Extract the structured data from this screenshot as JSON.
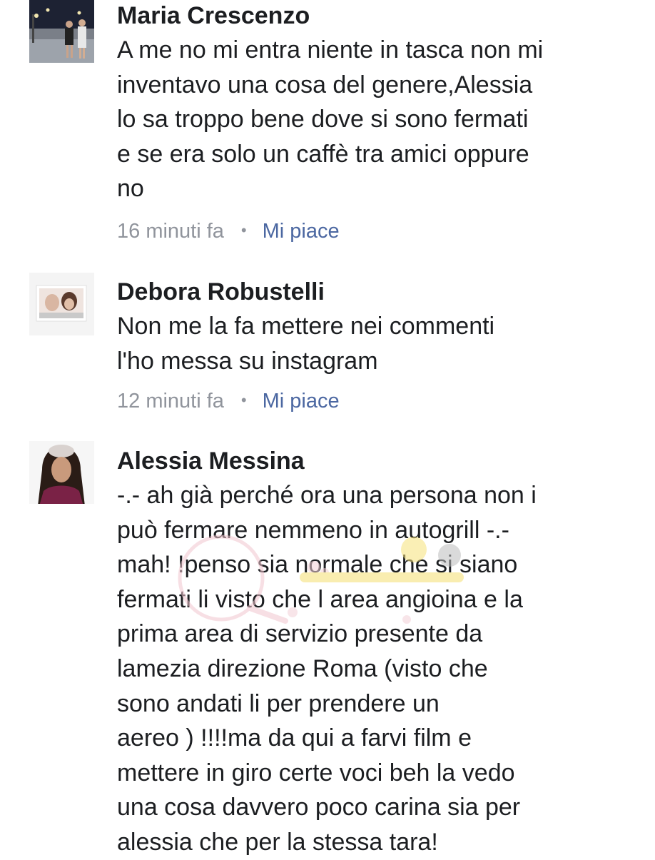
{
  "comments": [
    {
      "author": "Maria Crescenzo",
      "lines": [
        "A me no mi entra niente in tasca non mi",
        "inventavo una cosa del genere,Alessia",
        "lo sa troppo bene dove si sono fermati",
        "e se era solo un caffè tra amici oppure",
        "no"
      ],
      "time": "16 minuti fa",
      "separator": "•",
      "like_label": "Mi piace"
    },
    {
      "author": "Debora Robustelli",
      "lines": [
        "Non me la fa mettere  nei commenti",
        "l'ho messa su instagram"
      ],
      "time": "12 minuti fa",
      "separator": "•",
      "like_label": "Mi piace"
    },
    {
      "author": "Alessia Messina",
      "lines": [
        "-.- ah già perché ora una persona non i",
        "può fermare nemmeno in autogrill -.-",
        "mah! !penso sia normale che si siano",
        "fermati li visto che l area angioina e la",
        "prima area di servizio presente da",
        "lamezia direzione Roma  (visto che",
        "sono andati li per prendere un",
        "aereo ) !!!!ma da qui a farvi film e",
        "mettere in giro certe voci beh la vedo",
        "una cosa davvero poco carina sia per",
        "alessia che per la stessa tara!"
      ]
    }
  ],
  "colors": {
    "name": "#1c1e21",
    "meta": "#90949c",
    "like": "#4b67a1"
  }
}
